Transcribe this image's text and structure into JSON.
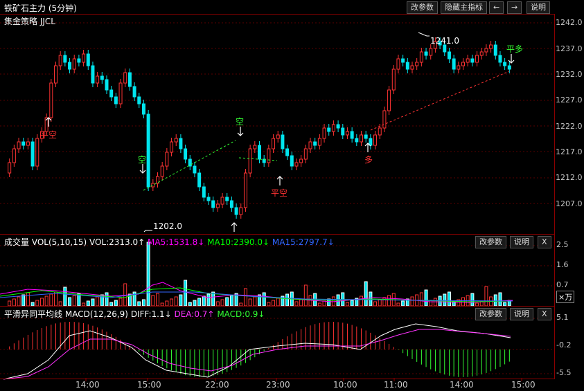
{
  "header": {
    "symbol_title": "铁矿石主力 (5分钟)",
    "strategy_label": "集金策略 JJCL",
    "buttons": {
      "params": "改参数",
      "hide_indicator": "隐藏主指标",
      "left": "←",
      "right": "→",
      "help": "说明"
    }
  },
  "price_axis": [
    "1242.0",
    "1237.0",
    "1232.0",
    "1227.0",
    "1222.0",
    "1217.0",
    "1212.0",
    "1207.0"
  ],
  "annotations": {
    "high": "1241.0",
    "low": "1202.0",
    "sig_pingkong1": "平空",
    "sig_kong1": "空",
    "sig_kong2": "空",
    "sig_pingkong2": "平空",
    "sig_duo": "多",
    "sig_pingduo": "平多"
  },
  "volume_panel": {
    "title": "成交量",
    "vol_params": "VOL(5,10,15)",
    "vol_value": "VOL:2313.0↑",
    "ma5": "MA5:1531.8↓",
    "ma10": "MA10:2390.0↓",
    "ma15": "MA15:2797.7↓",
    "axis": [
      "2.5",
      "1.6",
      "0.7"
    ],
    "unit": "×万",
    "buttons": {
      "params": "改参数",
      "help": "说明",
      "close": "X"
    },
    "colors": {
      "ma5": "#ff00ff",
      "ma10": "#00ff00",
      "ma15": "#2255ff"
    }
  },
  "macd_panel": {
    "title": "平滑异同平均线",
    "macd_params": "MACD(12,26,9)",
    "diff": "DIFF:1.1↓",
    "dea": "DEA:0.7↑",
    "macd": "MACD:0.9↓",
    "axis": [
      "5.1",
      "-0.2",
      "-5.5"
    ],
    "buttons": {
      "params": "改参数",
      "help": "说明",
      "close": "X"
    },
    "colors": {
      "diff": "#ffffff",
      "dea": "#ff00ff",
      "macd": "#00ff00"
    }
  },
  "time_axis": [
    "14:00",
    "15:00",
    "22:00",
    "23:00",
    "10:00",
    "11:00",
    "14:00",
    "15:00"
  ],
  "colors": {
    "up": "#ff3333",
    "down": "#00e5ee",
    "grid": "#8b0000"
  }
}
